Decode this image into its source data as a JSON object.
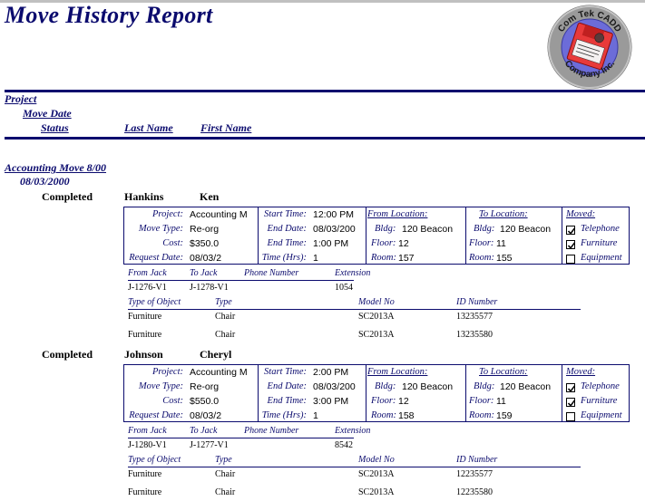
{
  "report": {
    "title": "Move History Report",
    "logo": {
      "top_text": "Com Tek CADD",
      "bottom_text": "Company Inc.",
      "icon": "floppy-disk-icon"
    }
  },
  "column_headers": {
    "project": "Project",
    "move_date": "Move Date",
    "status": "Status",
    "last_name": "Last Name",
    "first_name": "First Name"
  },
  "group": {
    "project": "Accounting Move 8/00",
    "move_date": "08/03/2000"
  },
  "labels": {
    "project": "Project:",
    "move_type": "Move Type:",
    "cost": "Cost:",
    "request_date": "Request Date:",
    "start_time": "Start Time:",
    "end_date": "End Date:",
    "end_time": "End Time:",
    "time_hrs": "Time (Hrs):",
    "from_location": "From Location:",
    "to_location": "To Location:",
    "bldg": "Bldg:",
    "floor": "Floor:",
    "room": "Room:",
    "moved": "Moved:",
    "telephone": "Telephone",
    "furniture": "Furniture",
    "equipment": "Equipment",
    "from_jack": "From Jack",
    "to_jack": "To Jack",
    "phone_number": "Phone Number",
    "extension": "Extension",
    "type_of_object": "Type of Object",
    "type": "Type",
    "model_no": "Model No",
    "id_number": "ID Number"
  },
  "records": [
    {
      "status": "Completed",
      "last_name": "Hankins",
      "first_name": "Ken",
      "project": "Accounting M",
      "move_type": "Re-org",
      "cost": "$350.0",
      "request_date": "08/03/2",
      "start_time": "12:00 PM",
      "end_date": "08/03/200",
      "end_time": "1:00 PM",
      "time_hrs": "1",
      "from": {
        "bldg": "120 Beacon",
        "floor": "12",
        "room": "157"
      },
      "to": {
        "bldg": "120 Beacon",
        "floor": "11",
        "room": "155"
      },
      "moved": {
        "telephone": true,
        "furniture": true,
        "equipment": false
      },
      "jack": {
        "from_jack": "J-1276-V1",
        "to_jack": "J-1278-V1",
        "phone_number": "",
        "extension": "1054"
      },
      "objects": [
        {
          "type_of_object": "Furniture",
          "type": "Chair",
          "model_no": "SC2013A",
          "id_number": "13235577"
        },
        {
          "type_of_object": "Furniture",
          "type": "Chair",
          "model_no": "SC2013A",
          "id_number": "13235580"
        }
      ]
    },
    {
      "status": "Completed",
      "last_name": "Johnson",
      "first_name": "Cheryl",
      "project": "Accounting M",
      "move_type": "Re-org",
      "cost": "$550.0",
      "request_date": "08/03/2",
      "start_time": "2:00 PM",
      "end_date": "08/03/200",
      "end_time": "3:00 PM",
      "time_hrs": "1",
      "from": {
        "bldg": "120 Beacon",
        "floor": "12",
        "room": "158"
      },
      "to": {
        "bldg": "120 Beacon",
        "floor": "11",
        "room": "159"
      },
      "moved": {
        "telephone": true,
        "furniture": true,
        "equipment": false
      },
      "jack": {
        "from_jack": "J-1280-V1",
        "to_jack": "J-1277-V1",
        "phone_number": "",
        "extension": "8542"
      },
      "objects": [
        {
          "type_of_object": "Furniture",
          "type": "Chair",
          "model_no": "SC2013A",
          "id_number": "12235577"
        },
        {
          "type_of_object": "Furniture",
          "type": "Chair",
          "model_no": "SC2013A",
          "id_number": "12235580"
        }
      ]
    }
  ]
}
